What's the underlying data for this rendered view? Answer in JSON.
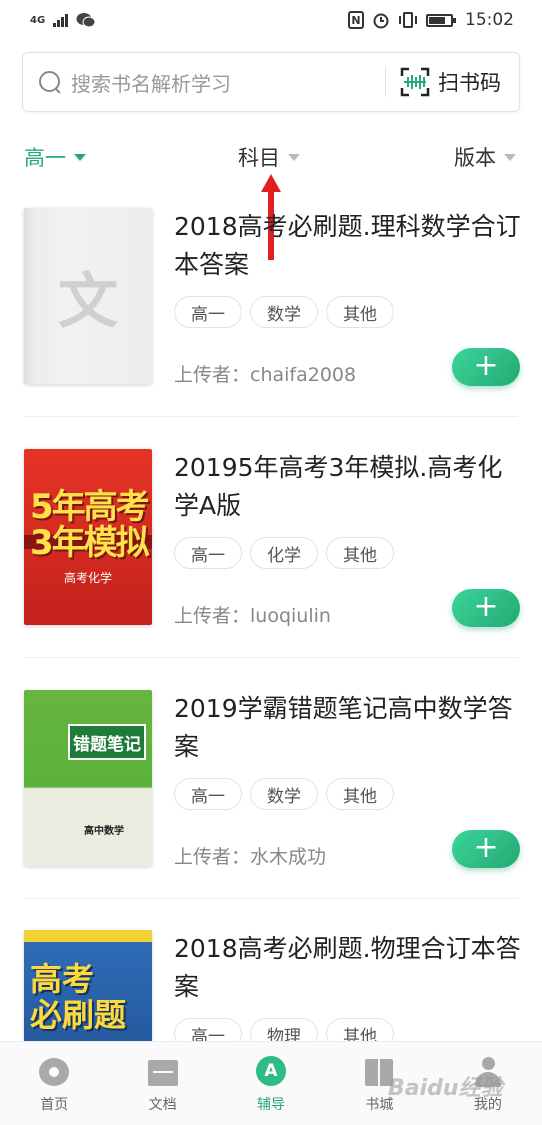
{
  "status_bar": {
    "network": "4G",
    "time": "15:02",
    "battery_level": 0.8
  },
  "search": {
    "placeholder": "搜索书名解析学习",
    "scan_label": "扫书码"
  },
  "filters": {
    "grade": "高一",
    "subject": "科目",
    "edition": "版本"
  },
  "books": [
    {
      "title": "2018高考必刷题.理科数学合订本答案",
      "tags": [
        "高一",
        "数学",
        "其他"
      ],
      "uploader": "上传者：chaifa2008",
      "cover_text": "文"
    },
    {
      "title": "20195年高考3年模拟.高考化学A版",
      "tags": [
        "高一",
        "化学",
        "其他"
      ],
      "uploader": "上传者：luoqiulin",
      "cover_text": [
        "5年高考",
        "3年模拟",
        "高考化学"
      ]
    },
    {
      "title": "2019学霸错题笔记高中数学答案",
      "tags": [
        "高一",
        "数学",
        "其他"
      ],
      "uploader": "上传者：水木成功",
      "cover_text": [
        "错题笔记",
        "高中数学"
      ]
    },
    {
      "title": "2018高考必刷题.物理合订本答案",
      "tags": [
        "高一",
        "物理",
        "其他"
      ],
      "uploader": "",
      "cover_text": [
        "高考",
        "必刷题"
      ]
    }
  ],
  "add_label": "+",
  "nav": [
    {
      "label": "首页",
      "icon": "home-icon",
      "active": false
    },
    {
      "label": "文档",
      "icon": "documents-icon",
      "active": false
    },
    {
      "label": "辅导",
      "icon": "tutoring-icon",
      "active": true
    },
    {
      "label": "书城",
      "icon": "bookstore-icon",
      "active": false
    },
    {
      "label": "我的",
      "icon": "profile-icon",
      "active": false
    }
  ],
  "watermark": "Baidu经验",
  "colors": {
    "accent": "#2aa77a",
    "annotation_arrow": "#e02020"
  }
}
